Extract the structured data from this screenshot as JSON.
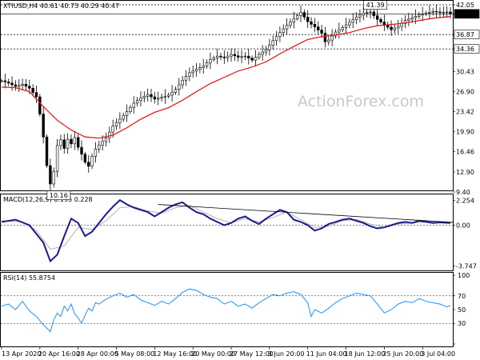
{
  "chart_data": [
    {
      "type": "candlestick",
      "title": "XTIUSD,H4  40.61 40.73 40.29 40.47",
      "watermark": "ActionForex.com",
      "ylim": [
        9.4,
        42.05
      ],
      "y_ticks": [
        "42.05",
        "40.47",
        "36.87",
        "34.36",
        "30.43",
        "26.90",
        "23.42",
        "19.90",
        "16.46",
        "12.90",
        "9.40"
      ],
      "y_tick_values": [
        42.05,
        40.47,
        36.87,
        34.36,
        30.43,
        26.9,
        23.42,
        19.9,
        16.46,
        12.9,
        9.4
      ],
      "highlighted_levels": [
        {
          "label": "42.05",
          "value": 42.05,
          "style": "dotted"
        },
        {
          "label": "40.47",
          "value": 40.47,
          "style": "solid",
          "boxed": true
        },
        {
          "label": "36.87",
          "value": 36.87,
          "style": "dotted",
          "boxed": true
        },
        {
          "label": "34.36",
          "value": 34.36,
          "style": "dotted",
          "boxed": true
        }
      ],
      "annotations": [
        {
          "text": "41.39",
          "x_index": 105,
          "y": 41.39
        },
        {
          "text": "10.16",
          "x_index": 14,
          "y": 10.16
        }
      ],
      "price_path": [
        [
          0,
          28.8
        ],
        [
          2,
          28.4
        ],
        [
          4,
          27.8
        ],
        [
          6,
          28.2
        ],
        [
          8,
          27.5
        ],
        [
          10,
          26.0
        ],
        [
          11,
          23.0
        ],
        [
          12,
          19.0
        ],
        [
          13,
          14.0
        ],
        [
          14,
          10.8
        ],
        [
          15,
          13.0
        ],
        [
          16,
          17.5
        ],
        [
          17,
          18.5
        ],
        [
          18,
          17.0
        ],
        [
          19,
          18.6
        ],
        [
          20,
          17.8
        ],
        [
          21,
          18.9
        ],
        [
          22,
          17.2
        ],
        [
          23,
          16.0
        ],
        [
          24,
          14.6
        ],
        [
          25,
          13.9
        ],
        [
          26,
          15.6
        ],
        [
          27,
          16.9
        ],
        [
          28,
          17.6
        ],
        [
          30,
          18.8
        ],
        [
          32,
          20.9
        ],
        [
          34,
          22.1
        ],
        [
          36,
          23.4
        ],
        [
          38,
          24.9
        ],
        [
          40,
          25.8
        ],
        [
          42,
          26.4
        ],
        [
          44,
          25.6
        ],
        [
          46,
          25.9
        ],
        [
          48,
          26.3
        ],
        [
          50,
          27.3
        ],
        [
          52,
          28.9
        ],
        [
          54,
          30.2
        ],
        [
          56,
          30.8
        ],
        [
          58,
          31.4
        ],
        [
          60,
          32.5
        ],
        [
          62,
          33.1
        ],
        [
          64,
          32.8
        ],
        [
          66,
          33.4
        ],
        [
          68,
          32.9
        ],
        [
          70,
          33.1
        ],
        [
          72,
          32.4
        ],
        [
          74,
          33.4
        ],
        [
          76,
          34.2
        ],
        [
          78,
          35.8
        ],
        [
          80,
          37.2
        ],
        [
          82,
          38.5
        ],
        [
          84,
          39.6
        ],
        [
          86,
          40.7
        ],
        [
          88,
          39.1
        ],
        [
          90,
          38.2
        ],
        [
          92,
          37.1
        ],
        [
          93,
          35.6
        ],
        [
          94,
          35.9
        ],
        [
          96,
          37.3
        ],
        [
          98,
          38.1
        ],
        [
          100,
          39.0
        ],
        [
          102,
          39.9
        ],
        [
          104,
          40.6
        ],
        [
          106,
          40.8
        ],
        [
          108,
          39.5
        ],
        [
          110,
          38.6
        ],
        [
          112,
          37.7
        ],
        [
          114,
          38.3
        ],
        [
          116,
          39.3
        ],
        [
          118,
          39.8
        ],
        [
          120,
          40.3
        ],
        [
          122,
          40.6
        ],
        [
          124,
          40.9
        ],
        [
          126,
          40.7
        ],
        [
          128,
          40.8
        ],
        [
          129,
          40.47
        ]
      ],
      "ma_path": [
        [
          0,
          27.7
        ],
        [
          4,
          27.6
        ],
        [
          8,
          26.9
        ],
        [
          12,
          24.3
        ],
        [
          16,
          21.9
        ],
        [
          20,
          20.2
        ],
        [
          24,
          19.0
        ],
        [
          28,
          18.8
        ],
        [
          32,
          19.3
        ],
        [
          36,
          20.6
        ],
        [
          40,
          22.1
        ],
        [
          44,
          23.3
        ],
        [
          48,
          24.1
        ],
        [
          52,
          25.4
        ],
        [
          56,
          26.9
        ],
        [
          60,
          28.3
        ],
        [
          64,
          29.4
        ],
        [
          68,
          30.5
        ],
        [
          72,
          31.2
        ],
        [
          76,
          32.1
        ],
        [
          80,
          33.5
        ],
        [
          84,
          34.8
        ],
        [
          88,
          36.0
        ],
        [
          92,
          36.5
        ],
        [
          96,
          36.8
        ],
        [
          100,
          37.2
        ],
        [
          104,
          37.9
        ],
        [
          108,
          38.4
        ],
        [
          112,
          38.6
        ],
        [
          116,
          38.9
        ],
        [
          120,
          39.3
        ],
        [
          124,
          39.7
        ],
        [
          129,
          40.0
        ]
      ],
      "x_labels": [
        "13 Apr 2020",
        "20 Apr 16:00",
        "28 Apr 00:00",
        "5 May 08:00",
        "12 May 16:00",
        "20 May 00:00",
        "27 May 12:00",
        "3 Jun 20:00",
        "11 Jun 04:00",
        "18 Jun 12:00",
        "25 Jun 20:00",
        "3 Jul 04:00"
      ],
      "x_label_index": [
        0,
        11,
        22,
        33,
        44,
        55,
        66,
        77,
        88,
        99,
        110,
        121
      ]
    },
    {
      "type": "line",
      "title": "MACD(12,26,9) 0.195 0.228",
      "ylim": [
        -4.0,
        2.6
      ],
      "y_ticks": [
        "2.254",
        "0.00",
        "-3.747"
      ],
      "y_tick_values": [
        2.254,
        0.0,
        -3.747
      ],
      "series": [
        {
          "values": [
            [
              0,
              0.3
            ],
            [
              4,
              0.5
            ],
            [
              8,
              0.0
            ],
            [
              12,
              -1.6
            ],
            [
              14,
              -3.3
            ],
            [
              16,
              -2.7
            ],
            [
              18,
              -1.0
            ],
            [
              20,
              0.6
            ],
            [
              22,
              0.2
            ],
            [
              24,
              -1.0
            ],
            [
              26,
              -0.6
            ],
            [
              28,
              0.2
            ],
            [
              30,
              1.0
            ],
            [
              32,
              1.7
            ],
            [
              34,
              2.3
            ],
            [
              36,
              1.9
            ],
            [
              38,
              1.6
            ],
            [
              40,
              1.4
            ],
            [
              42,
              1.2
            ],
            [
              44,
              0.8
            ],
            [
              46,
              1.2
            ],
            [
              48,
              1.6
            ],
            [
              50,
              1.9
            ],
            [
              52,
              2.1
            ],
            [
              54,
              1.6
            ],
            [
              56,
              1.2
            ],
            [
              58,
              1.0
            ],
            [
              60,
              0.6
            ],
            [
              62,
              0.3
            ],
            [
              64,
              0.0
            ],
            [
              66,
              0.2
            ],
            [
              68,
              0.6
            ],
            [
              70,
              0.8
            ],
            [
              72,
              0.4
            ],
            [
              74,
              0.1
            ],
            [
              76,
              0.6
            ],
            [
              78,
              1.0
            ],
            [
              80,
              1.4
            ],
            [
              82,
              1.2
            ],
            [
              84,
              0.5
            ],
            [
              86,
              0.3
            ],
            [
              88,
              0.0
            ],
            [
              90,
              -0.5
            ],
            [
              92,
              -0.3
            ],
            [
              94,
              0.1
            ],
            [
              96,
              0.3
            ],
            [
              98,
              0.5
            ],
            [
              100,
              0.6
            ],
            [
              102,
              0.4
            ],
            [
              104,
              0.2
            ],
            [
              106,
              -0.1
            ],
            [
              108,
              -0.3
            ],
            [
              110,
              -0.2
            ],
            [
              112,
              0.0
            ],
            [
              114,
              0.2
            ],
            [
              116,
              0.3
            ],
            [
              118,
              0.2
            ],
            [
              120,
              0.4
            ],
            [
              122,
              0.3
            ],
            [
              124,
              0.2
            ],
            [
              126,
              0.25
            ],
            [
              129,
              0.195
            ]
          ]
        },
        {
          "values": [
            [
              0,
              0.4
            ],
            [
              6,
              0.3
            ],
            [
              10,
              -0.5
            ],
            [
              14,
              -2.2
            ],
            [
              18,
              -1.9
            ],
            [
              22,
              -0.2
            ],
            [
              26,
              -0.4
            ],
            [
              30,
              0.4
            ],
            [
              34,
              1.6
            ],
            [
              38,
              1.7
            ],
            [
              42,
              1.3
            ],
            [
              46,
              1.1
            ],
            [
              50,
              1.6
            ],
            [
              54,
              1.8
            ],
            [
              58,
              1.2
            ],
            [
              62,
              0.6
            ],
            [
              66,
              0.2
            ],
            [
              70,
              0.6
            ],
            [
              74,
              0.3
            ],
            [
              78,
              0.7
            ],
            [
              82,
              1.2
            ],
            [
              86,
              0.5
            ],
            [
              90,
              -0.2
            ],
            [
              94,
              -0.1
            ],
            [
              98,
              0.4
            ],
            [
              102,
              0.5
            ],
            [
              106,
              0.1
            ],
            [
              110,
              -0.2
            ],
            [
              114,
              0.1
            ],
            [
              118,
              0.2
            ],
            [
              122,
              0.3
            ],
            [
              126,
              0.25
            ],
            [
              129,
              0.228
            ]
          ]
        }
      ],
      "trendline": [
        [
          45,
          1.9
        ],
        [
          130,
          0.25
        ]
      ]
    },
    {
      "type": "line",
      "title": "RSI(14) 55.8754",
      "ylim": [
        0,
        100
      ],
      "y_ticks": [
        "100",
        "70",
        "50",
        "30",
        "0"
      ],
      "y_tick_values": [
        100,
        70,
        50,
        30,
        0
      ],
      "series": [
        {
          "values": [
            [
              0,
              55
            ],
            [
              2,
              58
            ],
            [
              4,
              50
            ],
            [
              6,
              62
            ],
            [
              8,
              48
            ],
            [
              10,
              40
            ],
            [
              12,
              28
            ],
            [
              14,
              18
            ],
            [
              15,
              35
            ],
            [
              16,
              45
            ],
            [
              17,
              40
            ],
            [
              18,
              55
            ],
            [
              19,
              48
            ],
            [
              20,
              58
            ],
            [
              21,
              44
            ],
            [
              22,
              38
            ],
            [
              23,
              30
            ],
            [
              24,
              42
            ],
            [
              25,
              52
            ],
            [
              26,
              48
            ],
            [
              27,
              60
            ],
            [
              28,
              58
            ],
            [
              30,
              65
            ],
            [
              32,
              70
            ],
            [
              34,
              74
            ],
            [
              36,
              68
            ],
            [
              38,
              72
            ],
            [
              40,
              64
            ],
            [
              42,
              60
            ],
            [
              44,
              56
            ],
            [
              46,
              62
            ],
            [
              48,
              58
            ],
            [
              50,
              66
            ],
            [
              52,
              75
            ],
            [
              54,
              80
            ],
            [
              56,
              78
            ],
            [
              58,
              72
            ],
            [
              60,
              68
            ],
            [
              62,
              66
            ],
            [
              64,
              58
            ],
            [
              66,
              62
            ],
            [
              68,
              55
            ],
            [
              70,
              58
            ],
            [
              72,
              52
            ],
            [
              74,
              60
            ],
            [
              76,
              66
            ],
            [
              78,
              72
            ],
            [
              80,
              70
            ],
            [
              82,
              74
            ],
            [
              84,
              76
            ],
            [
              86,
              72
            ],
            [
              88,
              60
            ],
            [
              89,
              40
            ],
            [
              90,
              50
            ],
            [
              92,
              45
            ],
            [
              94,
              52
            ],
            [
              96,
              60
            ],
            [
              98,
              66
            ],
            [
              100,
              70
            ],
            [
              102,
              74
            ],
            [
              104,
              72
            ],
            [
              106,
              70
            ],
            [
              108,
              58
            ],
            [
              110,
              45
            ],
            [
              112,
              50
            ],
            [
              114,
              58
            ],
            [
              116,
              62
            ],
            [
              118,
              60
            ],
            [
              120,
              66
            ],
            [
              122,
              62
            ],
            [
              124,
              60
            ],
            [
              126,
              58
            ],
            [
              128,
              54
            ],
            [
              129,
              55.8754
            ]
          ]
        }
      ]
    }
  ],
  "colors": {
    "candle": "#000000",
    "ma": "#e02020",
    "macd_main": "#1a1a8c",
    "macd_signal": "#b8b8b8",
    "rsi": "#1e90ff",
    "grid": "#000000",
    "watermark": "#c8c8c8"
  }
}
